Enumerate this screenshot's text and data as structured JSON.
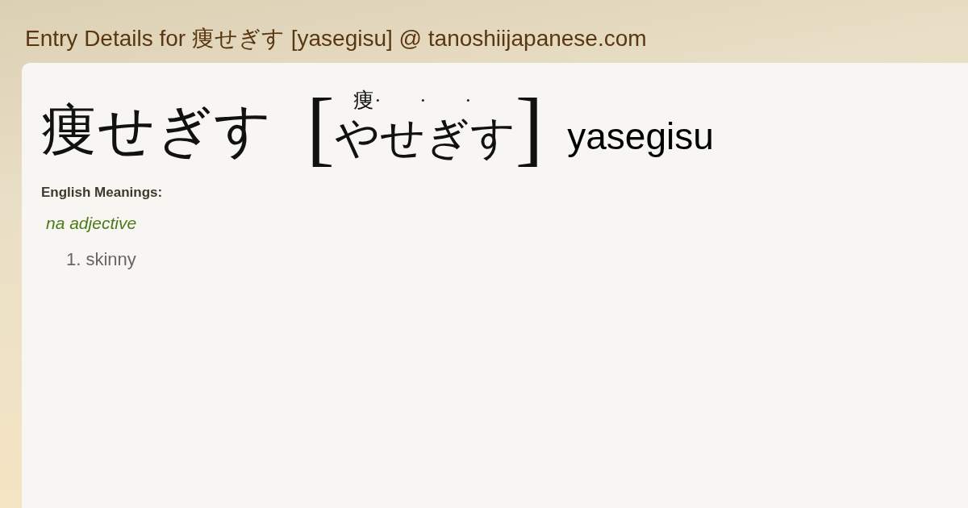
{
  "page_title": "Entry Details for 痩せぎす [yasegisu] @ tanoshiijapanese.com",
  "entry": {
    "headword": "痩せぎす",
    "bracket_open": "[",
    "reading": [
      {
        "kana": "や",
        "ruby": "痩·"
      },
      {
        "kana": "せ",
        "ruby": "·"
      },
      {
        "kana": "ぎ",
        "ruby": "·"
      },
      {
        "kana": "す"
      }
    ],
    "bracket_close": "]",
    "romaji": "yasegisu"
  },
  "meanings": {
    "heading": "English Meanings:",
    "groups": [
      {
        "pos": "na adjective",
        "senses": [
          {
            "number": "1.",
            "text": "skinny"
          }
        ]
      }
    ]
  }
}
